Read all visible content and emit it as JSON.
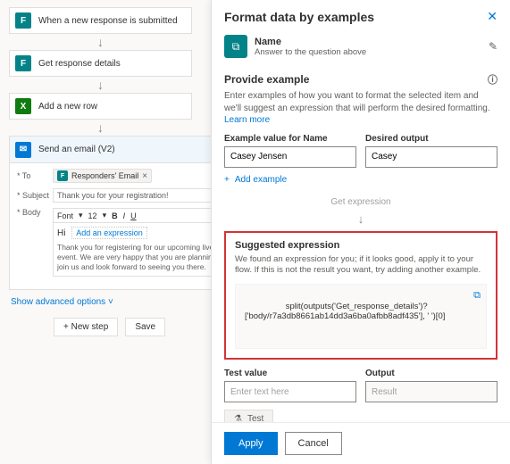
{
  "flow": {
    "step1": {
      "title": "When a new response is submitted",
      "icon": "F"
    },
    "step2": {
      "title": "Get response details",
      "icon": "F"
    },
    "step3": {
      "title": "Add a new row",
      "icon": "X"
    },
    "step4": {
      "title": "Send an email (V2)",
      "icon": "✉"
    }
  },
  "email": {
    "to_label": "* To",
    "to_chip": "Responders' Email",
    "subject_label": "* Subject",
    "subject_value": "Thank you for your registration!",
    "body_label": "* Body",
    "font_label": "Font",
    "font_size": "12",
    "hi": "Hi",
    "add_expr": "Add an expression",
    "body_text": "Thank you for registering for our upcoming live event. We are very happy that you are planning to join us and look forward to seeing you there.",
    "advanced": "Show advanced options",
    "new_step": "+ New step",
    "save": "Save"
  },
  "panel": {
    "title": "Format data by examples",
    "name_label": "Name",
    "name_sub": "Answer to the question above",
    "provide_h": "Provide example",
    "provide_d1": "Enter examples of how you want to format the selected item and we'll suggest an expression that will perform the desired formatting. ",
    "learn_more": "Learn more",
    "example_lbl": "Example value for Name",
    "example_val": "Casey Jensen",
    "desired_lbl": "Desired output",
    "desired_val": "Casey",
    "add_example": "Add example",
    "get_expression": "Get expression",
    "suggested_h": "Suggested expression",
    "suggested_d": "We found an expression for you; if it looks good, apply it to your flow. If this is not the result you want, try adding another example.",
    "code": "split(outputs('Get_response_details')?\n['body/r7a3db8661ab14dd3a6ba0afbb8adf435'], ' ')[0]",
    "test_lbl": "Test value",
    "test_ph": "Enter text here",
    "output_lbl": "Output",
    "output_ph": "Result",
    "test_btn": "Test",
    "apply": "Apply",
    "cancel": "Cancel"
  }
}
